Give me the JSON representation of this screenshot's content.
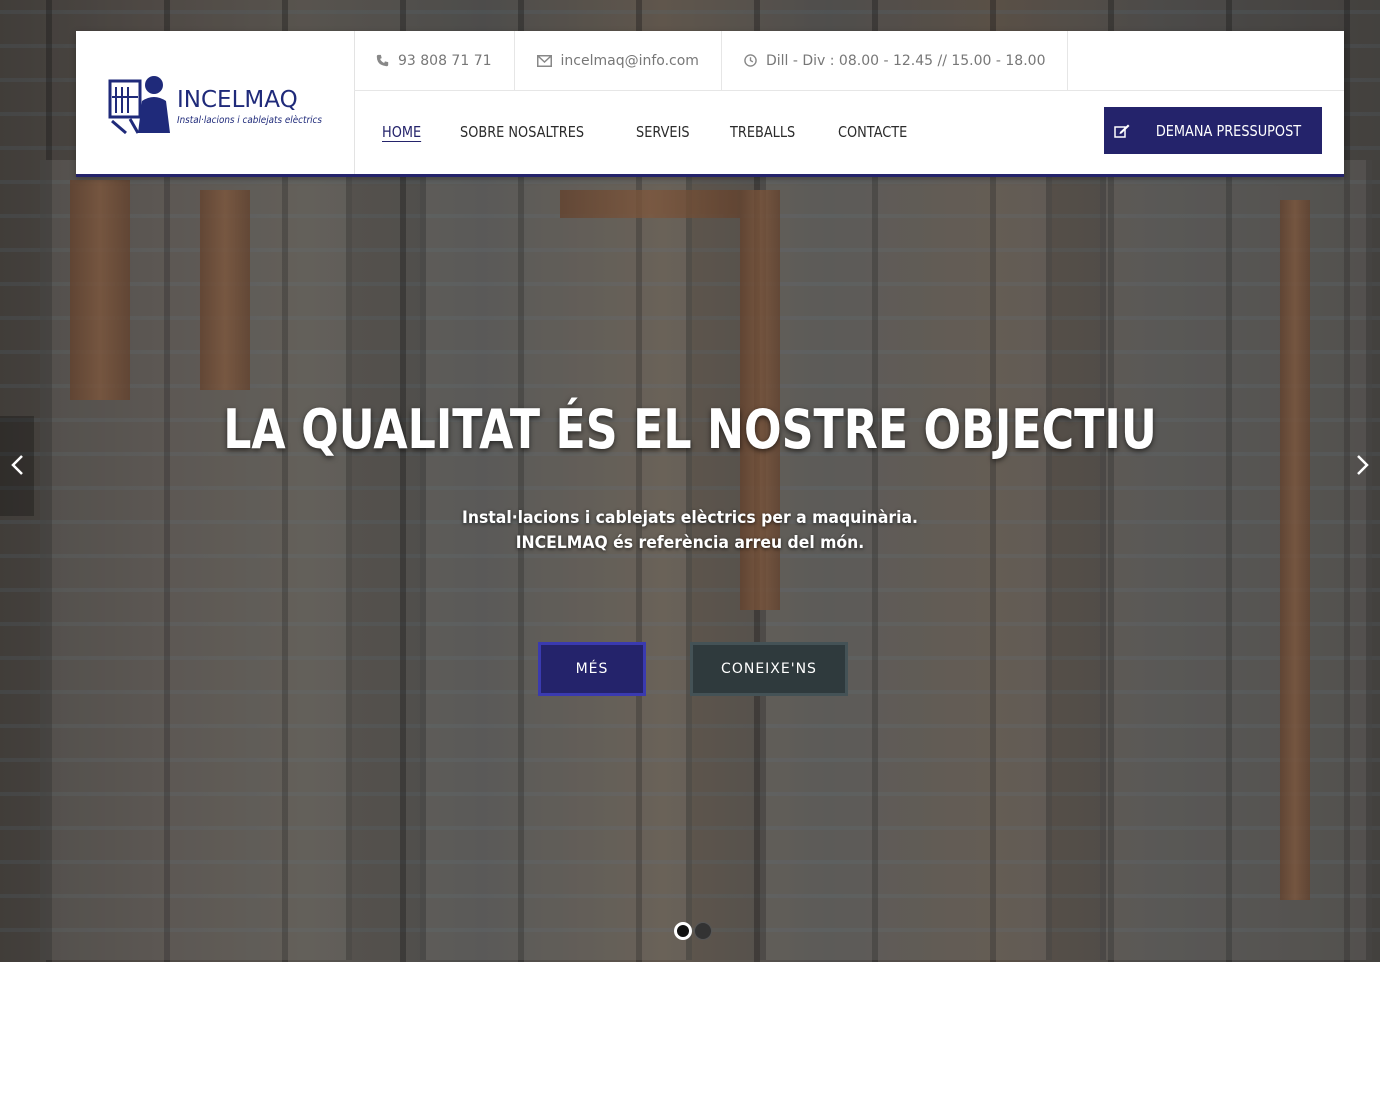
{
  "header": {
    "logo": {
      "name": "INCELMAQ",
      "tagline": "Instal·lacions i cablejats elèctrics"
    },
    "topbar": {
      "phone": "93 808 71 71",
      "email": "incelmaq@info.com",
      "hours": "Dill - Div : 08.00 - 12.45 // 15.00 - 18.00"
    },
    "nav": {
      "items": [
        {
          "label": "HOME",
          "active": true
        },
        {
          "label": "SOBRE NOSALTRES",
          "active": false
        },
        {
          "label": "SERVEIS",
          "active": false
        },
        {
          "label": "TREBALLS",
          "active": false
        },
        {
          "label": "CONTACTE",
          "active": false
        }
      ]
    },
    "quote_button": {
      "label": "DEMANA PRESSUPOST",
      "icon": "edit-icon"
    }
  },
  "hero": {
    "title": "LA QUALITAT ÉS EL NOSTRE OBJECTIU",
    "subtitle_line1": "Instal·lacions i cablejats elèctrics per a maquinària.",
    "subtitle_line2": "INCELMAQ és referència arreu del món.",
    "primary_button": "MÉS",
    "secondary_button": "CONEIXE'NS",
    "slides": {
      "count": 2,
      "active_index": 0
    },
    "arrows": {
      "prev": "chevron-left-icon",
      "next": "chevron-right-icon"
    }
  },
  "colors": {
    "brand": "#24236b",
    "secondary_button": "#2f3a3d",
    "text_muted": "#777777"
  }
}
